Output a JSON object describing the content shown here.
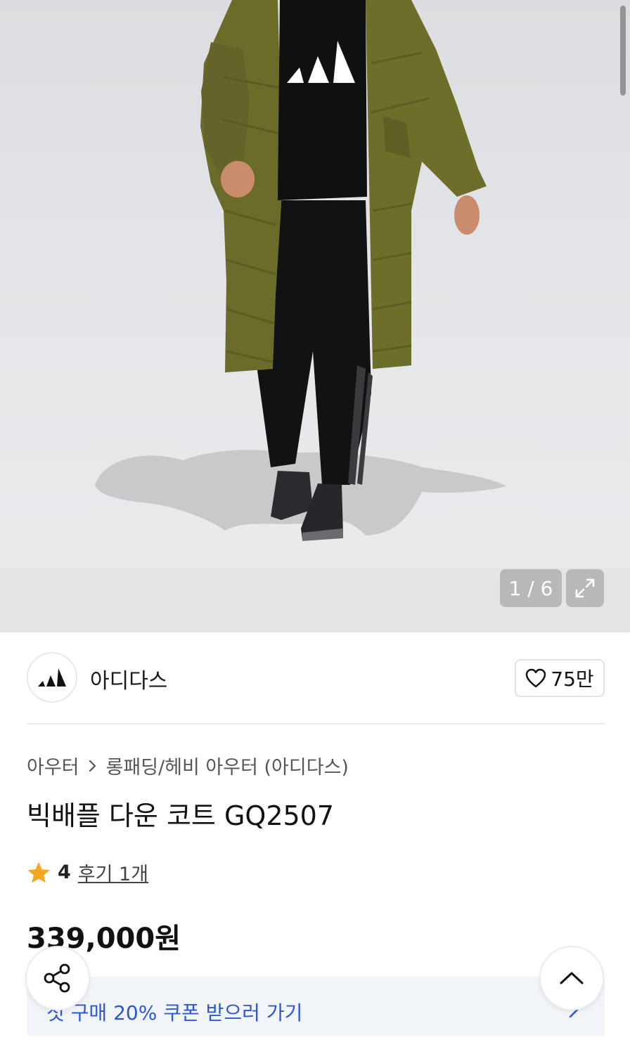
{
  "gallery": {
    "counter": "1 / 6",
    "image": "model wearing olive green long padded down coat with black adidas sweatshirt and pants"
  },
  "brand": {
    "name": "아디다스",
    "likes": "75만"
  },
  "product": {
    "breadcrumb_1": "아우터",
    "breadcrumb_2": "롱패딩/헤비 아우터 (아디다스)",
    "title": "빅배플 다운 코트 GQ2507",
    "rating": "4",
    "reviews": "후기 1개",
    "price": "339,000원"
  },
  "coupon": {
    "text": "첫 구매 20% 쿠폰 받으러 가기"
  },
  "colors": {
    "accent": "#2c57d6",
    "star": "#f5a623"
  },
  "icons": {
    "share": "share-icon",
    "scroll_top": "chevron-up-icon",
    "expand": "expand-icon",
    "heart": "heart-icon",
    "star": "star-icon"
  }
}
